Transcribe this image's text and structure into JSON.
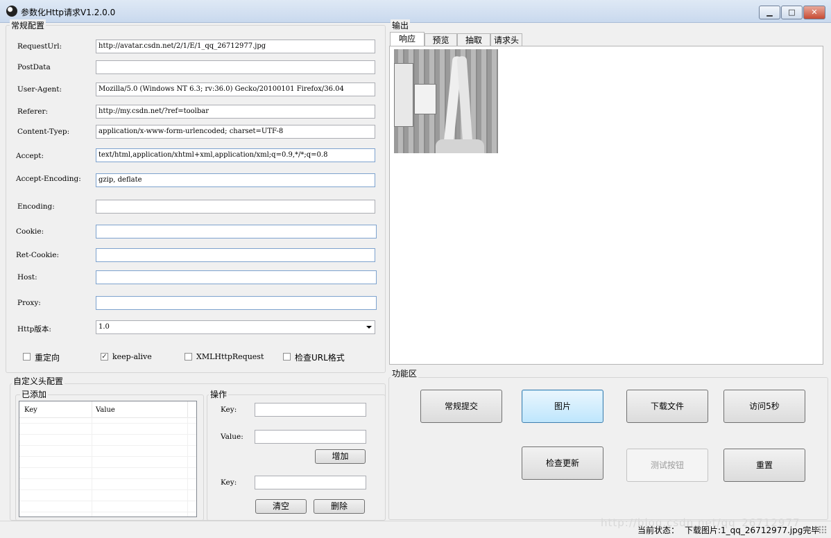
{
  "window": {
    "title": "参数化Http请求V1.2.0.0",
    "min": "▁",
    "max": "□",
    "close": "✕"
  },
  "general": {
    "title": "常规配置",
    "fields": [
      {
        "label": "RequestUrl:",
        "value": "http://avatar.csdn.net/2/1/E/1_qq_26712977.jpg"
      },
      {
        "label": "PostData",
        "value": ""
      },
      {
        "label": "User-Agent:",
        "value": "Mozilla/5.0 (Windows NT 6.3; rv:36.0) Gecko/20100101 Firefox/36.04"
      },
      {
        "label": "Referer:",
        "value": "http://my.csdn.net/?ref=toolbar"
      },
      {
        "label": "Content-Tyep:",
        "value": "application/x-www-form-urlencoded; charset=UTF-8"
      },
      {
        "label": "Accept:",
        "value": "text/html,application/xhtml+xml,application/xml;q=0.9,*/*;q=0.8"
      },
      {
        "label": "Accept-Encoding:",
        "value": "gzip, deflate"
      },
      {
        "label": "Encoding:",
        "value": ""
      },
      {
        "label": "Cookie:",
        "value": ""
      },
      {
        "label": "Ret-Cookie:",
        "value": ""
      },
      {
        "label": "Host:",
        "value": ""
      },
      {
        "label": "Proxy:",
        "value": ""
      }
    ],
    "http_version": {
      "label": "Http版本:",
      "value": "1.0"
    },
    "checkboxes": [
      {
        "label": "重定向",
        "checked": false
      },
      {
        "label": "keep-alive",
        "checked": true,
        "mark": "✓"
      },
      {
        "label": "XMLHttpRequest",
        "checked": false
      },
      {
        "label": "检查URL格式",
        "checked": false
      }
    ]
  },
  "custom_headers": {
    "title": "自定义头配置",
    "added_title": "已添加",
    "columns": [
      "Key",
      "Value"
    ],
    "ops_title": "操作",
    "key_label": "Key:",
    "value_label": "Value:",
    "key2_label": "Key:",
    "add_button": "增加",
    "clear_button": "清空",
    "delete_button": "删除"
  },
  "output": {
    "title": "输出",
    "tabs": [
      "响应",
      "预览",
      "抽取",
      "请求头"
    ]
  },
  "functions": {
    "title": "功能区",
    "buttons": {
      "submit": "常规提交",
      "image": "图片",
      "download": "下载文件",
      "visit5s": "访问5秒",
      "check_update": "检查更新",
      "test": "测试按钮",
      "reset": "重置"
    }
  },
  "status": {
    "label": "当前状态：",
    "text": "下载图片:1_qq_26712977.jpg完毕"
  },
  "watermark": "http://blog.csdn.net/qq_26712977"
}
